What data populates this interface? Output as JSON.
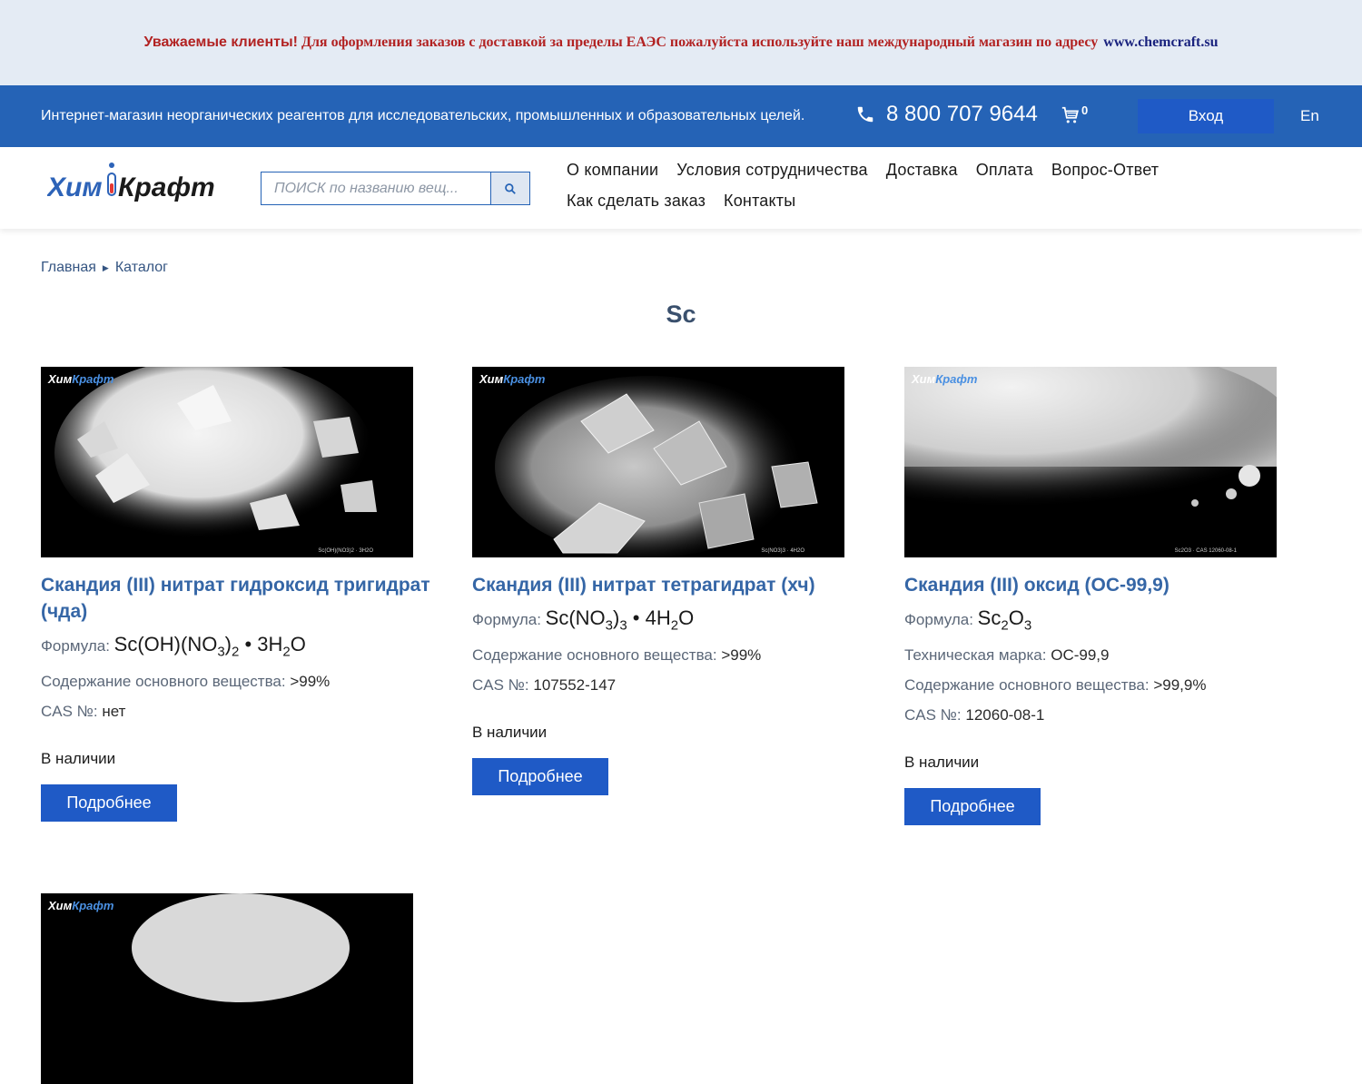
{
  "notice": {
    "lead": "Уважаемые клиенты!",
    "message": "Для оформления заказов с доставкой за пределы ЕАЭС пожалуйста используйте наш международный магазин по адресу",
    "link": "www.chemcraft.su"
  },
  "topbar": {
    "tagline": "Интернет-магазин неорганических реагентов для исследовательских, промышленных и образовательных целей.",
    "phone": "8 800 707 9644",
    "cart_count": "0",
    "login": "Вход",
    "language": "En"
  },
  "header": {
    "logo_text": "ХимКрафт",
    "search_placeholder": "ПОИСК по названию вещ...",
    "nav": [
      "О компании",
      "Условия сотрудничества",
      "Доставка",
      "Оплата",
      "Вопрос-Ответ",
      "Как сделать заказ",
      "Контакты"
    ]
  },
  "breadcrumb": [
    "Главная",
    "Каталог"
  ],
  "page_title": "Sc",
  "labels": {
    "formula": "Формула:",
    "content": "Содержание основного вещества:",
    "cas": "CAS №:",
    "grade": "Техническая марка:",
    "more": "Подробнее"
  },
  "products": [
    {
      "name": "Скандия (III) нитрат гидроксид тригидрат (чда)",
      "formula": "Sc(OH)(NO<sub>3</sub>)<sub>2</sub> • 3H<sub>2</sub>O",
      "content": ">99%",
      "cas": "нет",
      "stock": "В наличии",
      "watermark": "ХимКрафт",
      "caption": "Sc(OH)(NO3)2 · 3H2O"
    },
    {
      "name": "Скандия (III) нитрат тетрагидрат (хч)",
      "formula": "Sc(NO<sub>3</sub>)<sub>3</sub> • 4H<sub>2</sub>O",
      "content": ">99%",
      "cas": "107552-147",
      "stock": "В наличии",
      "watermark": "ХимКрафт",
      "caption": "Sc(NO3)3 · 4H2O"
    },
    {
      "name": "Скандия (III) оксид (ОС-99,9)",
      "formula": "Sc<sub>2</sub>O<sub>3</sub>",
      "grade": "ОС-99,9",
      "content": ">99,9%",
      "cas": "12060-08-1",
      "stock": "В наличии",
      "watermark": "ХимКрафт",
      "caption": "Sc2O3 · CAS 12060-08-1"
    },
    {
      "watermark": "ХимКрафт"
    }
  ]
}
